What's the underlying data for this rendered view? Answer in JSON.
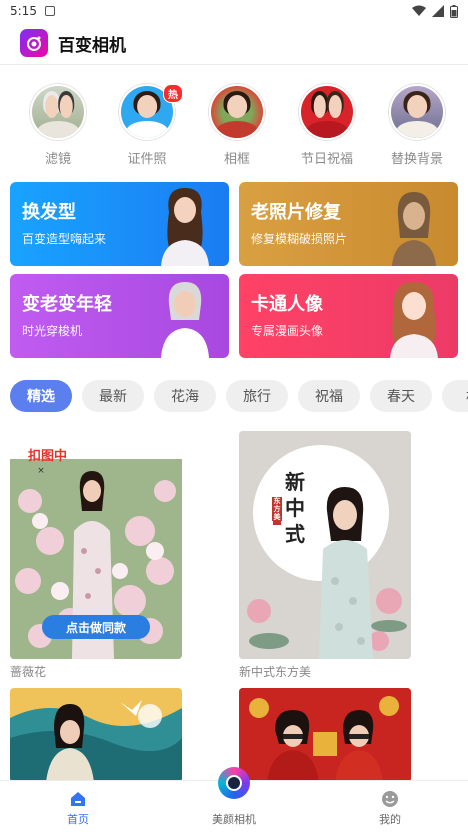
{
  "status_bar": {
    "time": "5:15"
  },
  "header": {
    "title": "百变相机"
  },
  "features": [
    {
      "label": "滤镜",
      "icon": "filter-avatar"
    },
    {
      "label": "证件照",
      "icon": "id-photo-avatar",
      "badge": "热"
    },
    {
      "label": "相框",
      "icon": "frame-avatar"
    },
    {
      "label": "节日祝福",
      "icon": "holiday-avatar"
    },
    {
      "label": "替换背景",
      "icon": "background-avatar"
    }
  ],
  "cards": [
    {
      "title": "换发型",
      "subtitle": "百变造型嗨起来",
      "color": "#1f9bff"
    },
    {
      "title": "老照片修复",
      "subtitle": "修复模糊破损照片",
      "color": "#d09838"
    },
    {
      "title": "变老变年轻",
      "subtitle": "时光穿梭机",
      "color": "#b14fe6"
    },
    {
      "title": "卡通人像",
      "subtitle": "专属漫画头像",
      "color": "#f43f66"
    }
  ],
  "tabs": [
    "精选",
    "最新",
    "花海",
    "旅行",
    "祝福",
    "春天",
    "林"
  ],
  "active_tab": "精选",
  "templates": [
    {
      "caption": "蔷薇花",
      "tag": "扣图中",
      "button": "点击做同款"
    },
    {
      "caption": "新中式东方美",
      "art_text": "新中式",
      "seal": "东方美"
    },
    {
      "caption": ""
    },
    {
      "caption": ""
    }
  ],
  "bottom_nav": {
    "home": "首页",
    "camera": "美颜相机",
    "mine": "我的"
  },
  "colors": {
    "accent": "#5b7fee",
    "hot": "#ff2a2a",
    "nav_active": "#3574f0"
  }
}
